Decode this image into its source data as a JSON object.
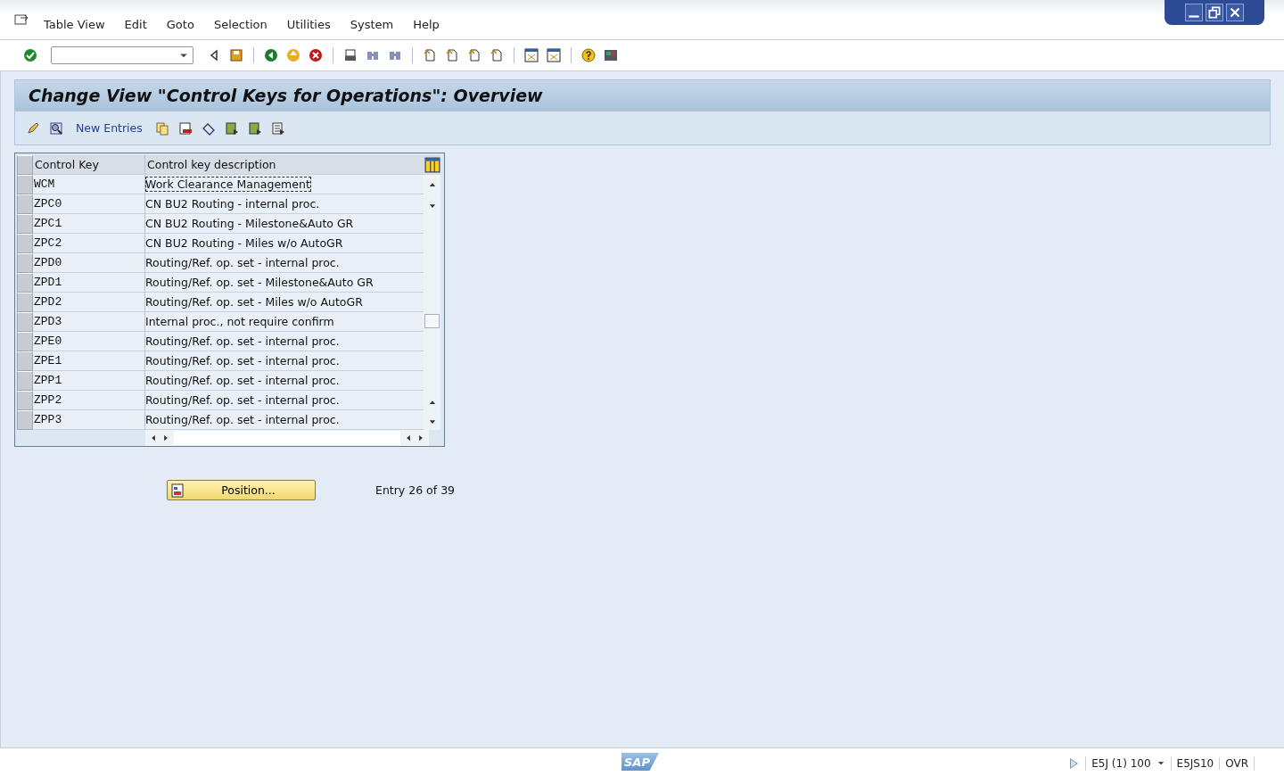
{
  "menu": [
    "Table View",
    "Edit",
    "Goto",
    "Selection",
    "Utilities",
    "System",
    "Help"
  ],
  "title": "Change View \"Control Keys for Operations\": Overview",
  "app_toolbar": {
    "new_entries": "New Entries"
  },
  "table": {
    "columns": [
      "Control Key",
      "Control key description"
    ],
    "rows": [
      {
        "key": "WCM",
        "description": "Work Clearance Management",
        "focused": true
      },
      {
        "key": "ZPC0",
        "description": "CN BU2 Routing - internal proc.",
        "focused": false
      },
      {
        "key": "ZPC1",
        "description": "CN BU2 Routing - Milestone&Auto GR",
        "focused": false
      },
      {
        "key": "ZPC2",
        "description": "CN BU2 Routing - Miles w/o AutoGR",
        "focused": false
      },
      {
        "key": "ZPD0",
        "description": "Routing/Ref. op. set - internal proc.",
        "focused": false
      },
      {
        "key": "ZPD1",
        "description": "Routing/Ref. op. set - Milestone&Auto GR",
        "focused": false
      },
      {
        "key": "ZPD2",
        "description": "Routing/Ref. op. set - Miles w/o AutoGR",
        "focused": false
      },
      {
        "key": "ZPD3",
        "description": "Internal proc., not require confirm",
        "focused": false
      },
      {
        "key": "ZPE0",
        "description": "Routing/Ref. op. set - internal proc.",
        "focused": false
      },
      {
        "key": "ZPE1",
        "description": "Routing/Ref. op. set - internal proc.",
        "focused": false
      },
      {
        "key": "ZPP1",
        "description": "Routing/Ref. op. set - internal proc.",
        "focused": false
      },
      {
        "key": "ZPP2",
        "description": "Routing/Ref. op. set - internal proc.",
        "focused": false
      },
      {
        "key": "ZPP3",
        "description": "Routing/Ref. op. set - internal proc.",
        "focused": false
      }
    ]
  },
  "position_button": "Position...",
  "entry_info": "Entry 26 of 39",
  "status_bar": {
    "logo": "SAP",
    "system": "E5J (1) 100",
    "server": "E5JS10",
    "mode": "OVR"
  }
}
